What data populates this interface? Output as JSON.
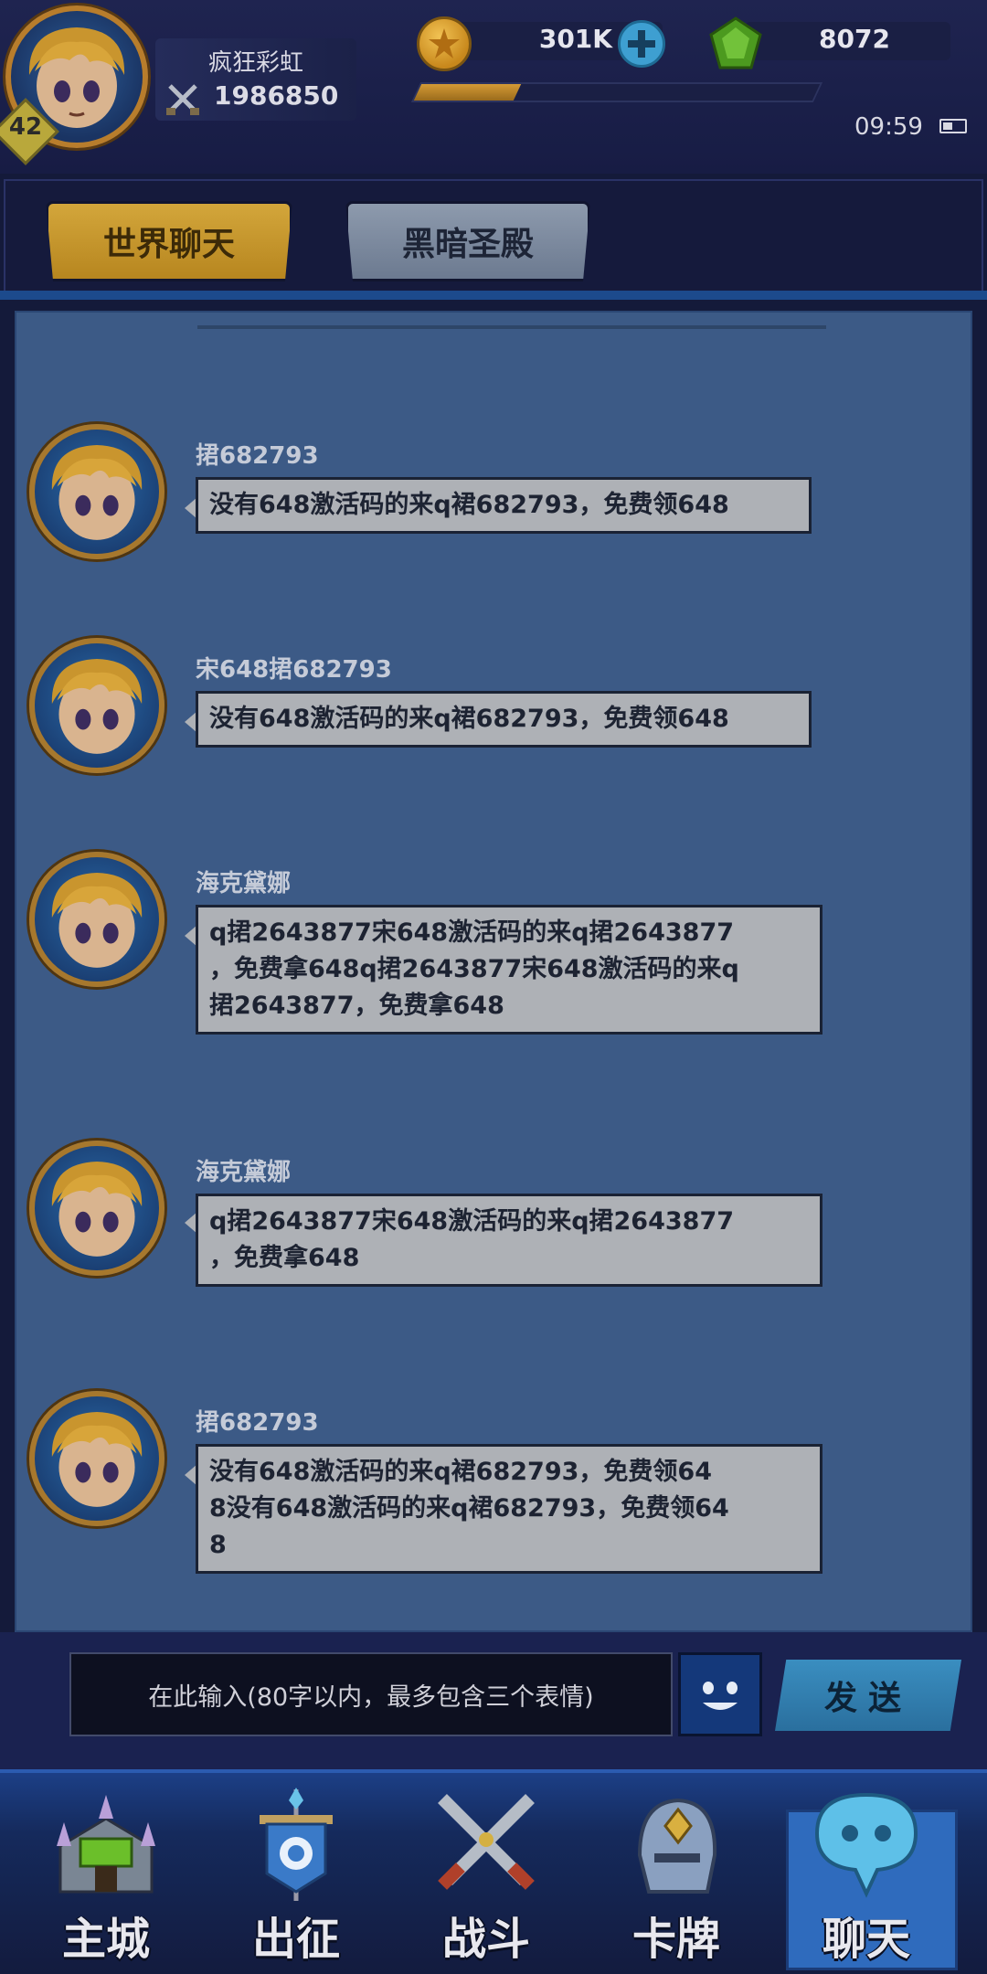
{
  "player": {
    "level": "42",
    "name": "疯狂彩虹",
    "power": "1986850"
  },
  "currency": {
    "coins": "301K",
    "gems": "8072",
    "exp_progress": 0.25
  },
  "status": {
    "time": "09:59"
  },
  "tabs": [
    {
      "label": "世界聊天",
      "active": true
    },
    {
      "label": "黑暗圣殿",
      "active": false
    }
  ],
  "messages": [
    {
      "name": "捃682793",
      "text": "没有648激活码的来q裙682793，免费领648"
    },
    {
      "name": "宋648捃682793",
      "text": "没有648激活码的来q裙682793，免费领648"
    },
    {
      "name": "海克黛娜",
      "text": "q捃2643877宋648激活码的来q捃2643877\n，免费拿648q捃2643877宋648激活码的来q\n捃2643877，免费拿648"
    },
    {
      "name": "海克黛娜",
      "text": "q捃2643877宋648激活码的来q捃2643877\n，免费拿648"
    },
    {
      "name": "捃682793",
      "text": "没有648激活码的来q裙682793，免费领64\n8没有648激活码的来q裙682793，免费领64\n8"
    }
  ],
  "input": {
    "placeholder": "在此输入(80字以内，最多包含三个表情)",
    "send_label": "发送"
  },
  "nav": [
    {
      "label": "主城",
      "icon": "castle-icon"
    },
    {
      "label": "出征",
      "icon": "banner-icon"
    },
    {
      "label": "战斗",
      "icon": "crossed-swords-icon"
    },
    {
      "label": "卡牌",
      "icon": "helmet-icon"
    },
    {
      "label": "聊天",
      "icon": "chat-bubble-icon",
      "active": true
    }
  ],
  "colors": {
    "gold_tab": "#d3a63b",
    "chat_bg": "#3c5a86",
    "bubble": "#aeb1b6",
    "send_btn": "#3a8ec0"
  }
}
